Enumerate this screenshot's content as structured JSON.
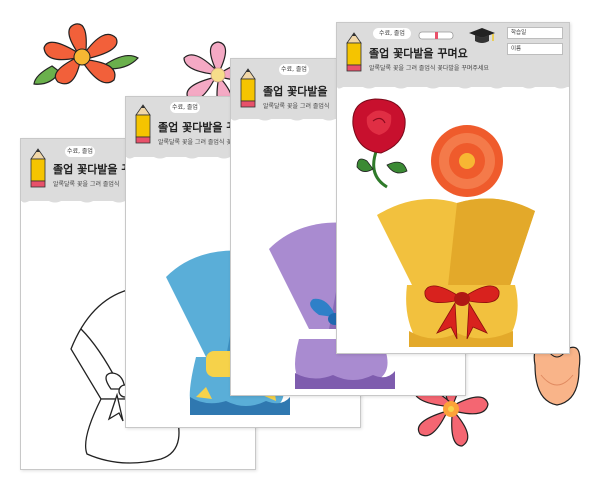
{
  "worksheet": {
    "tag": "수료, 졸업",
    "title": "졸업 꽃다발을 꾸며요",
    "title_short": "졸업 꽃다발을 꾸",
    "title_shorter": "졸업 꽃다발을",
    "title_tiny": "졸업 꽃다발을 꾸",
    "subtitle": "알록달록 꽃을 그려 졸업식 꽃다발을 꾸며주세요",
    "subtitle_short": "알록달록 꽃을 그려 졸업식 꽃",
    "subtitle_tiny": "알록달록 꽃을 그려 졸업식",
    "fields": [
      "학습일",
      "이름"
    ]
  },
  "icons": [
    "pencil-icon",
    "graduation-cap-icon",
    "diploma-icon",
    "ribbon-bow-icon"
  ],
  "colors": {
    "header_gray": "#dcdcdc",
    "pencil_yellow": "#f5c400",
    "blue_wrap": "#5aaed8",
    "purple_wrap": "#a98bd0",
    "gold_wrap": "#f2c13e",
    "red_bow": "#d8221e",
    "orange_flower": "#ef5b2c",
    "pink_flower": "#f3a6c3"
  }
}
